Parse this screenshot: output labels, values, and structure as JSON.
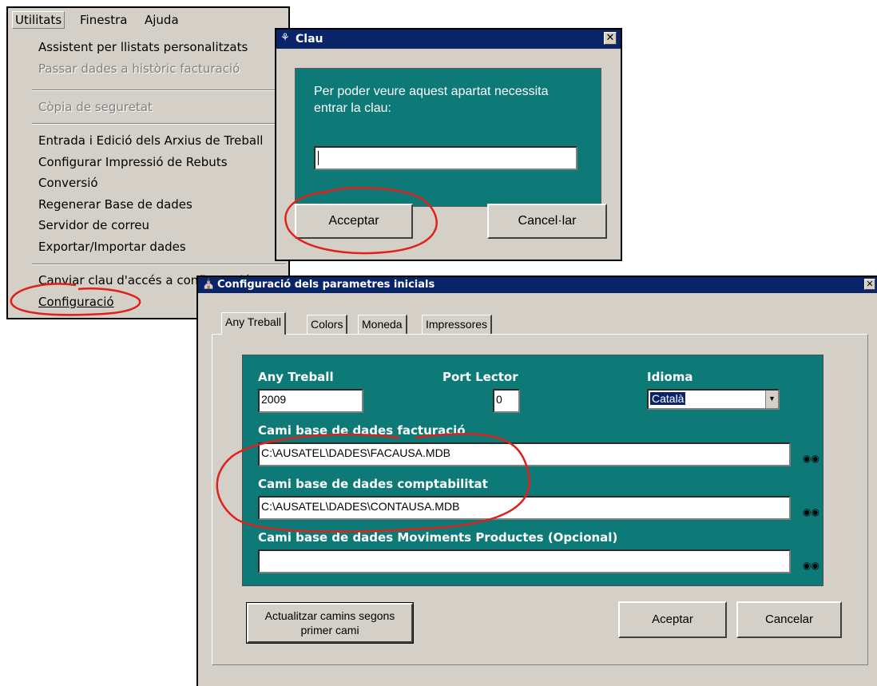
{
  "menu": {
    "bar": [
      "Utilitats",
      "Finestra",
      "Ajuda"
    ],
    "items": [
      {
        "label": "Assistent per llistats personalitzats",
        "disabled": false
      },
      {
        "label": "Passar dades a històric facturació",
        "disabled": true
      },
      {
        "label": "Còpia de seguretat",
        "disabled": true
      },
      {
        "label": "Entrada i Edició dels Arxius de Treball",
        "disabled": false
      },
      {
        "label": "Configurar Impressió de Rebuts",
        "disabled": false
      },
      {
        "label": "Conversió",
        "disabled": false
      },
      {
        "label": "Regenerar Base de dades",
        "disabled": false
      },
      {
        "label": "Servidor de correu",
        "disabled": false
      },
      {
        "label": "Exportar/Importar dades",
        "disabled": false
      },
      {
        "label": "Canviar clau d'accés a configuració",
        "disabled": false
      },
      {
        "label": "Configuració",
        "disabled": false
      }
    ]
  },
  "clau": {
    "title": "Clau",
    "message": "Per poder veure aquest apartat necessita entrar la clau:",
    "password_value": "",
    "accept_label": "Acceptar",
    "cancel_label": "Cancel·lar",
    "close_glyph": "✕"
  },
  "config": {
    "title": "Configuració dels parametres inicials",
    "close_glyph": "✕",
    "tabs": [
      "Any Treball",
      "Colors",
      "Moneda",
      "Impressores"
    ],
    "any_treball_label": "Any Treball",
    "any_treball_value": "2009",
    "port_lector_label": "Port Lector",
    "port_lector_value": "0",
    "idioma_label": "Idioma",
    "idioma_value": "Català",
    "facturacio_label": "Cami base de dades facturació",
    "facturacio_value": "C:\\AUSATEL\\DADES\\FACAUSA.MDB",
    "comptabilitat_label": "Cami base de dades comptabilitat",
    "comptabilitat_value": "C:\\AUSATEL\\DADES\\CONTAUSA.MDB",
    "moviments_label": "Cami base de dades Moviments Productes (Opcional)",
    "moviments_value": "",
    "update_button_line1": "Actualitzar camins segons",
    "update_button_line2": "primer cami",
    "accept_label": "Aceptar",
    "cancel_label": "Cancelar"
  },
  "colors": {
    "teal": "#0e7a78",
    "title_blue": "#0a246a",
    "face": "#d4d0c8",
    "annotation_red": "#e0201a"
  }
}
